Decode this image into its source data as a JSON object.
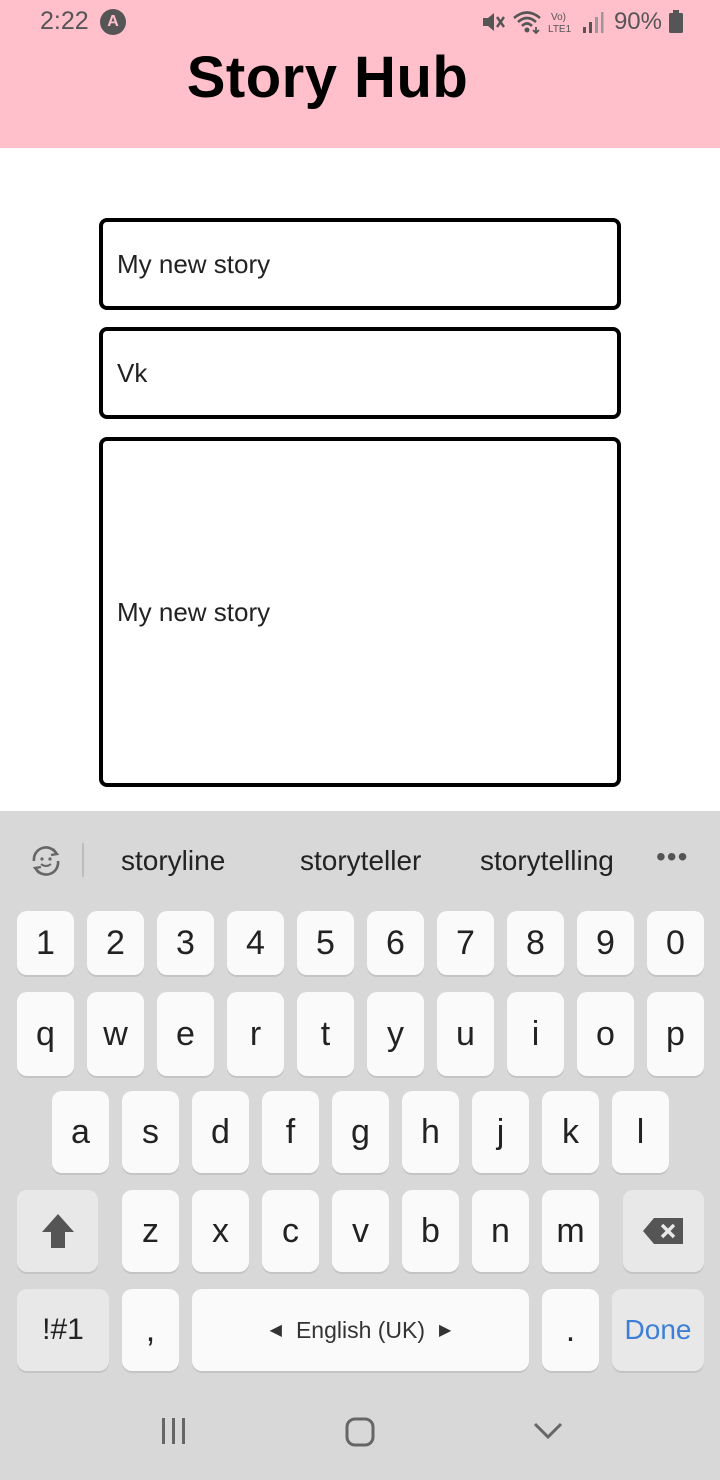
{
  "status_bar": {
    "time": "2:22",
    "app_icon": "A",
    "battery_percent": "90%",
    "icons": [
      "mute-icon",
      "wifi-icon",
      "volte-lte-icon",
      "signal-icon",
      "battery-icon"
    ]
  },
  "header": {
    "title": "Story Hub",
    "background_color": "#ffc0cb"
  },
  "form": {
    "title_value": "My new story",
    "author_value": "Vk",
    "story_value": "My new story"
  },
  "keyboard": {
    "suggestions": [
      "storyline",
      "storyteller",
      "storytelling"
    ],
    "more_label": "•••",
    "number_row": [
      "1",
      "2",
      "3",
      "4",
      "5",
      "6",
      "7",
      "8",
      "9",
      "0"
    ],
    "row1": [
      "q",
      "w",
      "e",
      "r",
      "t",
      "y",
      "u",
      "i",
      "o",
      "p"
    ],
    "row2": [
      "a",
      "s",
      "d",
      "f",
      "g",
      "h",
      "j",
      "k",
      "l"
    ],
    "row3": [
      "z",
      "x",
      "c",
      "v",
      "b",
      "n",
      "m"
    ],
    "symbols_label": "!#1",
    "comma_label": ",",
    "space_label": "English (UK)",
    "period_label": ".",
    "done_label": "Done",
    "done_color": "#3d7fd6"
  },
  "nav_bar": {
    "items": [
      "recent-apps-icon",
      "home-icon",
      "back-icon"
    ]
  }
}
